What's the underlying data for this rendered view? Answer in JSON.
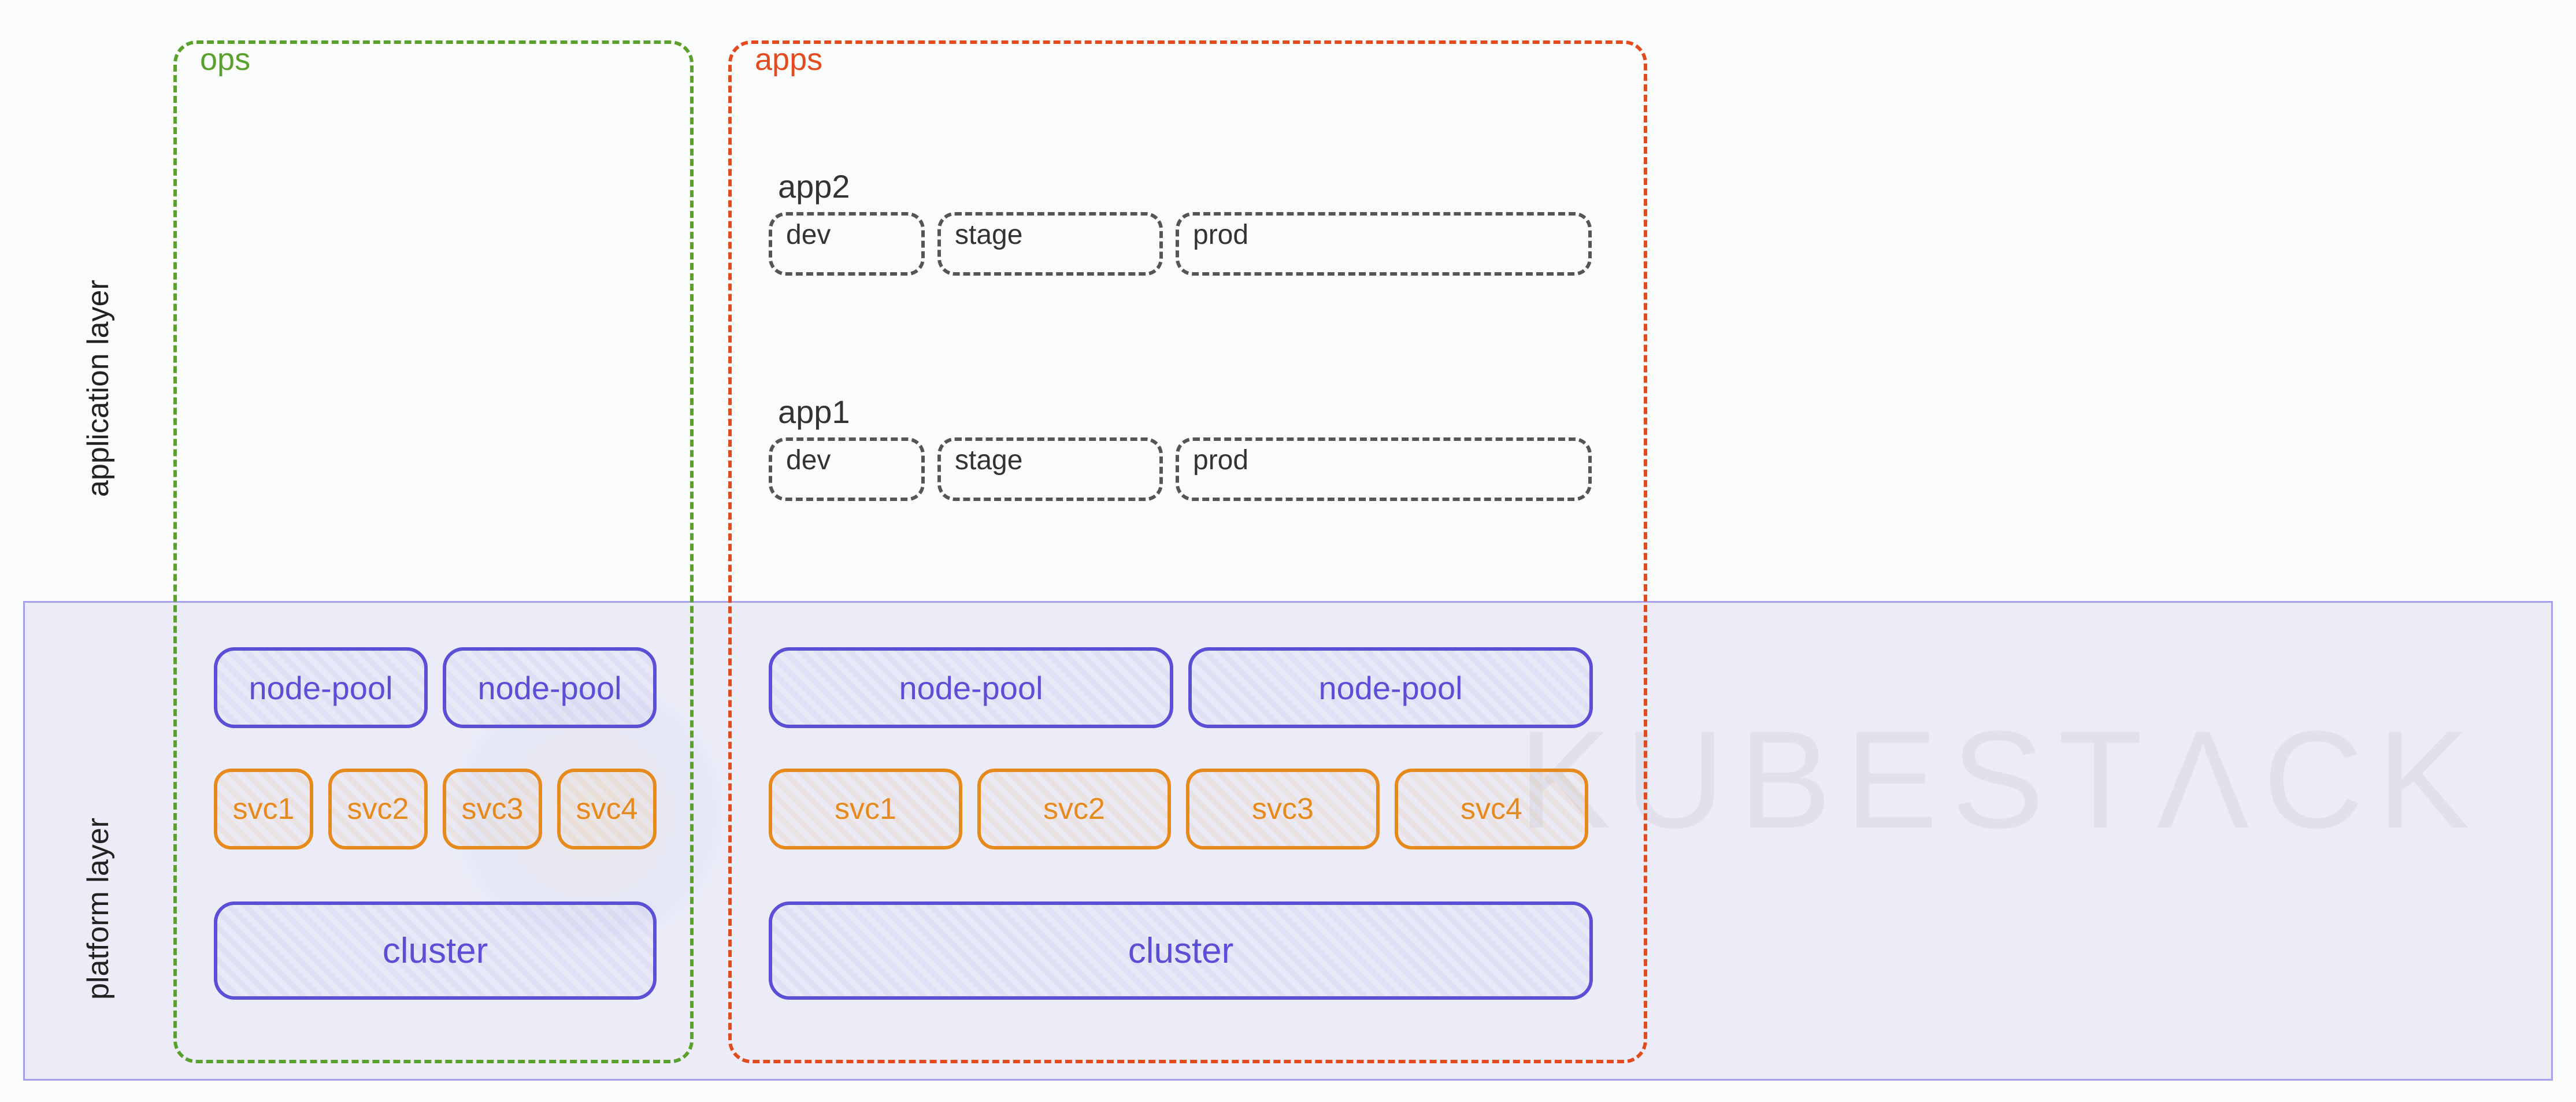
{
  "layers": {
    "application": "application layer",
    "platform": "platform layer"
  },
  "columns": {
    "ops": {
      "label": "ops"
    },
    "apps": {
      "label": "apps"
    }
  },
  "apps_column": {
    "app2": {
      "title": "app2",
      "envs": {
        "dev": "dev",
        "stage": "stage",
        "prod": "prod"
      }
    },
    "app1": {
      "title": "app1",
      "envs": {
        "dev": "dev",
        "stage": "stage",
        "prod": "prod"
      }
    }
  },
  "platform": {
    "ops": {
      "node_pools": [
        "node-pool",
        "node-pool"
      ],
      "services": [
        "svc1",
        "svc2",
        "svc3",
        "svc4"
      ],
      "cluster": "cluster"
    },
    "apps": {
      "node_pools": [
        "node-pool",
        "node-pool"
      ],
      "services": [
        "svc1",
        "svc2",
        "svc3",
        "svc4"
      ],
      "cluster": "cluster"
    }
  },
  "watermark": "KUBESTΛCK",
  "colors": {
    "ops_border": "#5aa02c",
    "apps_border": "#e34b1f",
    "node_pool": "#5b4fd6",
    "service": "#e68a1e",
    "cluster": "#5b4fd6",
    "platform_fill": "rgba(120,120,220,0.12)"
  }
}
